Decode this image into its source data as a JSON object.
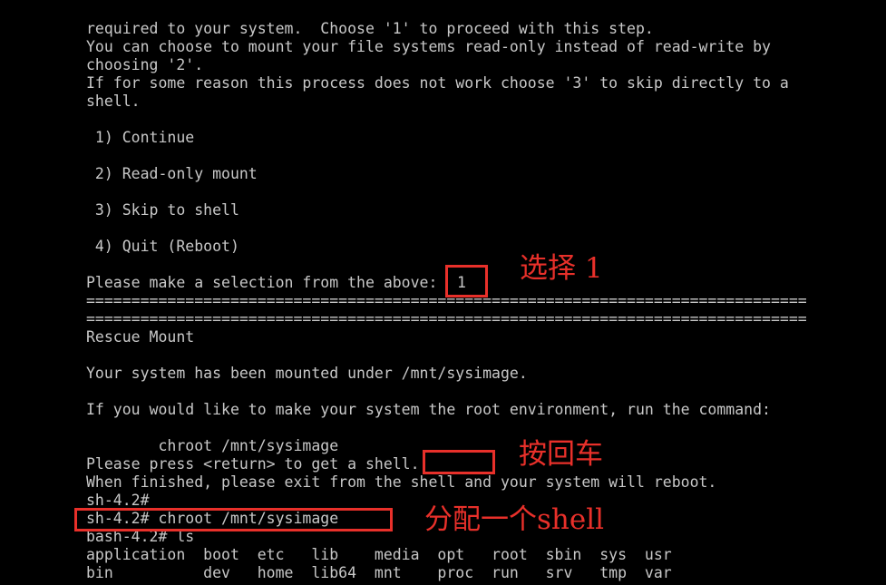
{
  "terminal": {
    "lines": [
      "required to your system.  Choose '1' to proceed with this step.",
      "You can choose to mount your file systems read-only instead of read-write by",
      "choosing '2'.",
      "If for some reason this process does not work choose '3' to skip directly to a",
      "shell.",
      "",
      " 1) Continue",
      "",
      " 2) Read-only mount",
      "",
      " 3) Skip to shell",
      "",
      " 4) Quit (Reboot)",
      "",
      "Please make a selection from the above:",
      "================================================================================",
      "================================================================================",
      "Rescue Mount",
      "",
      "Your system has been mounted under /mnt/sysimage.",
      "",
      "If you would like to make your system the root environment, run the command:",
      "",
      "        chroot /mnt/sysimage",
      "Please press <return> to get a shell.",
      "When finished, please exit from the shell and your system will reboot.",
      "sh-4.2#",
      "sh-4.2# chroot /mnt/sysimage",
      "bash-4.2# ls",
      "application  boot  etc   lib    media  opt   root  sbin  sys  usr",
      "bin          dev   home  lib64  mnt    proc  run   srv   tmp  var"
    ],
    "selection_input": "1"
  },
  "annotations": {
    "select_label": "选择 1",
    "enter_label": "按回车",
    "shell_label": "分配一个shell",
    "color": "#e8302a"
  },
  "colors": {
    "background": "#000000",
    "text": "#c8c8c8"
  }
}
